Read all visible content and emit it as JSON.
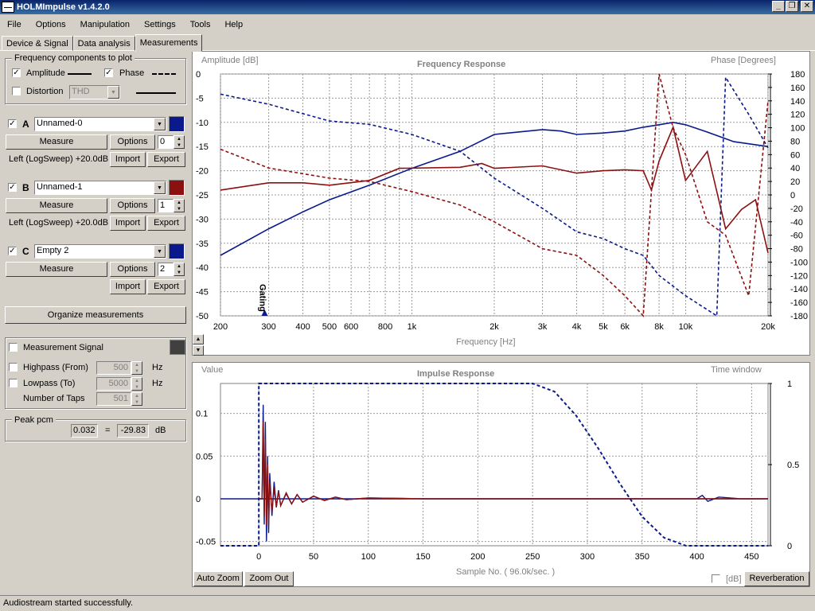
{
  "window": {
    "title": "HOLMImpulse  v1.4.2.0"
  },
  "menu": [
    "File",
    "Options",
    "Manipulation",
    "Settings",
    "Tools",
    "Help"
  ],
  "tabs": [
    "Device & Signal",
    "Data analysis",
    "Measurements"
  ],
  "freq_components": {
    "legend": "Frequency components to plot",
    "amplitude_label": "Amplitude",
    "phase_label": "Phase",
    "distortion_label": "Distortion",
    "distortion_select": "THD",
    "amplitude_checked": true,
    "phase_checked": true,
    "distortion_checked": false
  },
  "measurements": [
    {
      "letter": "A",
      "name": "Unnamed-0",
      "color": "#0a1a8c",
      "index": "0",
      "info": "Left (LogSweep) +20.0dB",
      "checked": true
    },
    {
      "letter": "B",
      "name": "Unnamed-1",
      "color": "#8b1010",
      "index": "1",
      "info": "Left (LogSweep) +20.0dB",
      "checked": true
    },
    {
      "letter": "C",
      "name": "Empty 2",
      "color": "#0a1a8c",
      "index": "2",
      "info": "",
      "checked": true
    }
  ],
  "measure_label": "Measure",
  "options_label": "Options",
  "import_label": "Import",
  "export_label": "Export",
  "organize_label": "Organize measurements",
  "signal": {
    "label": "Measurement Signal",
    "highpass_label": "Highpass (From)",
    "highpass_value": "500",
    "lowpass_label": "Lowpass (To)",
    "lowpass_value": "5000",
    "taps_label": "Number of Taps",
    "taps_value": "501",
    "hz": "Hz"
  },
  "peak": {
    "legend": "Peak pcm",
    "value": "0.032",
    "eq": "=",
    "db_value": "-29.83",
    "unit": "dB"
  },
  "freq_plot": {
    "title": "Frequency Response",
    "ylabel": "Amplitude [dB]",
    "y2label": "Phase [Degrees]",
    "xlabel": "Frequency [Hz]",
    "gating_label": "Gating",
    "xticks": [
      "200",
      "300",
      "400",
      "500",
      "600",
      "800",
      "1k",
      "2k",
      "3k",
      "4k",
      "5k",
      "6k",
      "8k",
      "10k",
      "20k"
    ],
    "yticks": [
      "0",
      "-5",
      "-10",
      "-15",
      "-20",
      "-25",
      "-30",
      "-35",
      "-40",
      "-45",
      "-50"
    ],
    "y2ticks": [
      "180",
      "160",
      "140",
      "120",
      "100",
      "80",
      "60",
      "40",
      "20",
      "0",
      "-20",
      "-40",
      "-60",
      "-80",
      "-100",
      "-120",
      "-140",
      "-160",
      "-180"
    ]
  },
  "imp_plot": {
    "title": "Impulse Response",
    "ylabel": "Value",
    "y2label": "Time window",
    "xlabel": "Sample No. ( 96.0k/sec. )",
    "xticks": [
      "0",
      "50",
      "100",
      "150",
      "200",
      "250",
      "300",
      "350",
      "400",
      "450"
    ],
    "yticks": [
      "0.1",
      "0.05",
      "0",
      "-0.05"
    ],
    "y2ticks": [
      "1",
      "0.5",
      "0"
    ]
  },
  "auto_zoom_label": "Auto Zoom",
  "zoom_out_label": "Zoom Out",
  "db_label": "[dB]",
  "reverb_label": "Reverberation",
  "status": "Audiostream started successfully.",
  "chart_data": [
    {
      "type": "line",
      "title": "Frequency Response",
      "xlabel": "Frequency [Hz]",
      "ylabel": "Amplitude [dB]",
      "y2label": "Phase [Degrees]",
      "xscale": "log",
      "xlim": [
        200,
        20000
      ],
      "ylim": [
        -50,
        0
      ],
      "y2lim": [
        -180,
        180
      ],
      "grid": true,
      "series": [
        {
          "axis": "amplitude",
          "color": "#0a1a8c",
          "style": "solid",
          "x": [
            200,
            300,
            400,
            500,
            700,
            1000,
            1500,
            2000,
            3000,
            3500,
            4000,
            5000,
            6000,
            7000,
            8000,
            9000,
            10000,
            12000,
            15000,
            20000
          ],
          "y": [
            -37.5,
            -32,
            -28.5,
            -26,
            -23,
            -19.5,
            -16,
            -12.5,
            -11.5,
            -11.8,
            -12.5,
            -12.2,
            -11.8,
            -11,
            -10.5,
            -10,
            -10.5,
            -12,
            -14,
            -15
          ]
        },
        {
          "axis": "amplitude",
          "color": "#8b1010",
          "style": "solid",
          "x": [
            200,
            300,
            400,
            500,
            700,
            900,
            1500,
            1800,
            2000,
            3000,
            4000,
            5000,
            6000,
            7000,
            7500,
            8000,
            9000,
            10000,
            12000,
            14000,
            16000,
            18000,
            20000
          ],
          "y": [
            -24,
            -22.5,
            -22.5,
            -23,
            -22,
            -19.5,
            -19.3,
            -18.5,
            -19.5,
            -19,
            -20.5,
            -20,
            -19.8,
            -20,
            -24,
            -18,
            -11,
            -22,
            -16,
            -32,
            -28,
            -26,
            -37
          ]
        },
        {
          "axis": "phase",
          "color": "#0a1a8c",
          "style": "dashed",
          "x": [
            200,
            300,
            500,
            700,
            1000,
            1500,
            2000,
            3000,
            4000,
            5000,
            6000,
            7000,
            8000,
            10000,
            13000,
            14000,
            17000,
            20000
          ],
          "y": [
            150,
            135,
            110,
            105,
            90,
            65,
            25,
            -20,
            -55,
            -65,
            -80,
            -90,
            -120,
            -150,
            -180,
            175,
            120,
            70
          ]
        },
        {
          "axis": "phase",
          "color": "#8b1010",
          "style": "dashed",
          "x": [
            200,
            300,
            500,
            700,
            1000,
            1500,
            2000,
            3000,
            4000,
            5000,
            6000,
            7000,
            8000,
            9000,
            10000,
            12000,
            14000,
            17000,
            20000
          ],
          "y": [
            68,
            40,
            25,
            20,
            5,
            -15,
            -40,
            -80,
            -90,
            -120,
            -150,
            -180,
            180,
            100,
            60,
            -40,
            -60,
            -150,
            140
          ]
        }
      ]
    },
    {
      "type": "line",
      "title": "Impulse Response",
      "xlabel": "Sample No. ( 96.0k/sec. )",
      "ylabel": "Value",
      "y2label": "Time window",
      "xlim": [
        0,
        465
      ],
      "ylim": [
        -0.055,
        0.135
      ],
      "y2lim": [
        0,
        1
      ],
      "grid": true,
      "series": [
        {
          "axis": "value",
          "color": "#0a1a8c",
          "style": "solid",
          "x": [
            0,
            3,
            4,
            5,
            6,
            7,
            8,
            9,
            10,
            12,
            14,
            16,
            18,
            20,
            25,
            30,
            35,
            40,
            50,
            60,
            70,
            80,
            100,
            150,
            200,
            400,
            405,
            410,
            420,
            440,
            465
          ],
          "y": [
            0,
            0,
            0.11,
            -0.03,
            0.09,
            -0.05,
            0.05,
            -0.04,
            0.03,
            -0.02,
            0.02,
            -0.01,
            0.01,
            -0.008,
            0.006,
            -0.006,
            0.005,
            -0.004,
            0.003,
            -0.002,
            0.002,
            -0.001,
            0.001,
            0,
            0,
            0,
            0.004,
            -0.003,
            0.002,
            0,
            0
          ]
        },
        {
          "axis": "value",
          "color": "#8b1010",
          "style": "solid",
          "x": [
            0,
            3,
            4,
            5,
            6,
            7,
            8,
            9,
            10,
            12,
            14,
            16,
            18,
            20,
            25,
            30,
            35,
            40,
            50,
            60,
            70,
            80,
            100,
            150,
            400,
            465
          ],
          "y": [
            0,
            0,
            0.09,
            -0.02,
            0.07,
            -0.03,
            0.04,
            -0.03,
            0.02,
            -0.015,
            0.012,
            -0.01,
            0.009,
            -0.008,
            0.007,
            -0.006,
            0.005,
            -0.004,
            0.003,
            -0.002,
            0.002,
            -0.001,
            0.001,
            0,
            0,
            0
          ]
        },
        {
          "axis": "window",
          "color": "#0a1a8c",
          "style": "dashed",
          "x": [
            -35,
            0,
            0,
            250,
            270,
            290,
            310,
            330,
            350,
            370,
            390,
            465
          ],
          "y": [
            0,
            0,
            1,
            1,
            0.95,
            0.8,
            0.6,
            0.38,
            0.18,
            0.05,
            0,
            0
          ]
        }
      ]
    }
  ]
}
